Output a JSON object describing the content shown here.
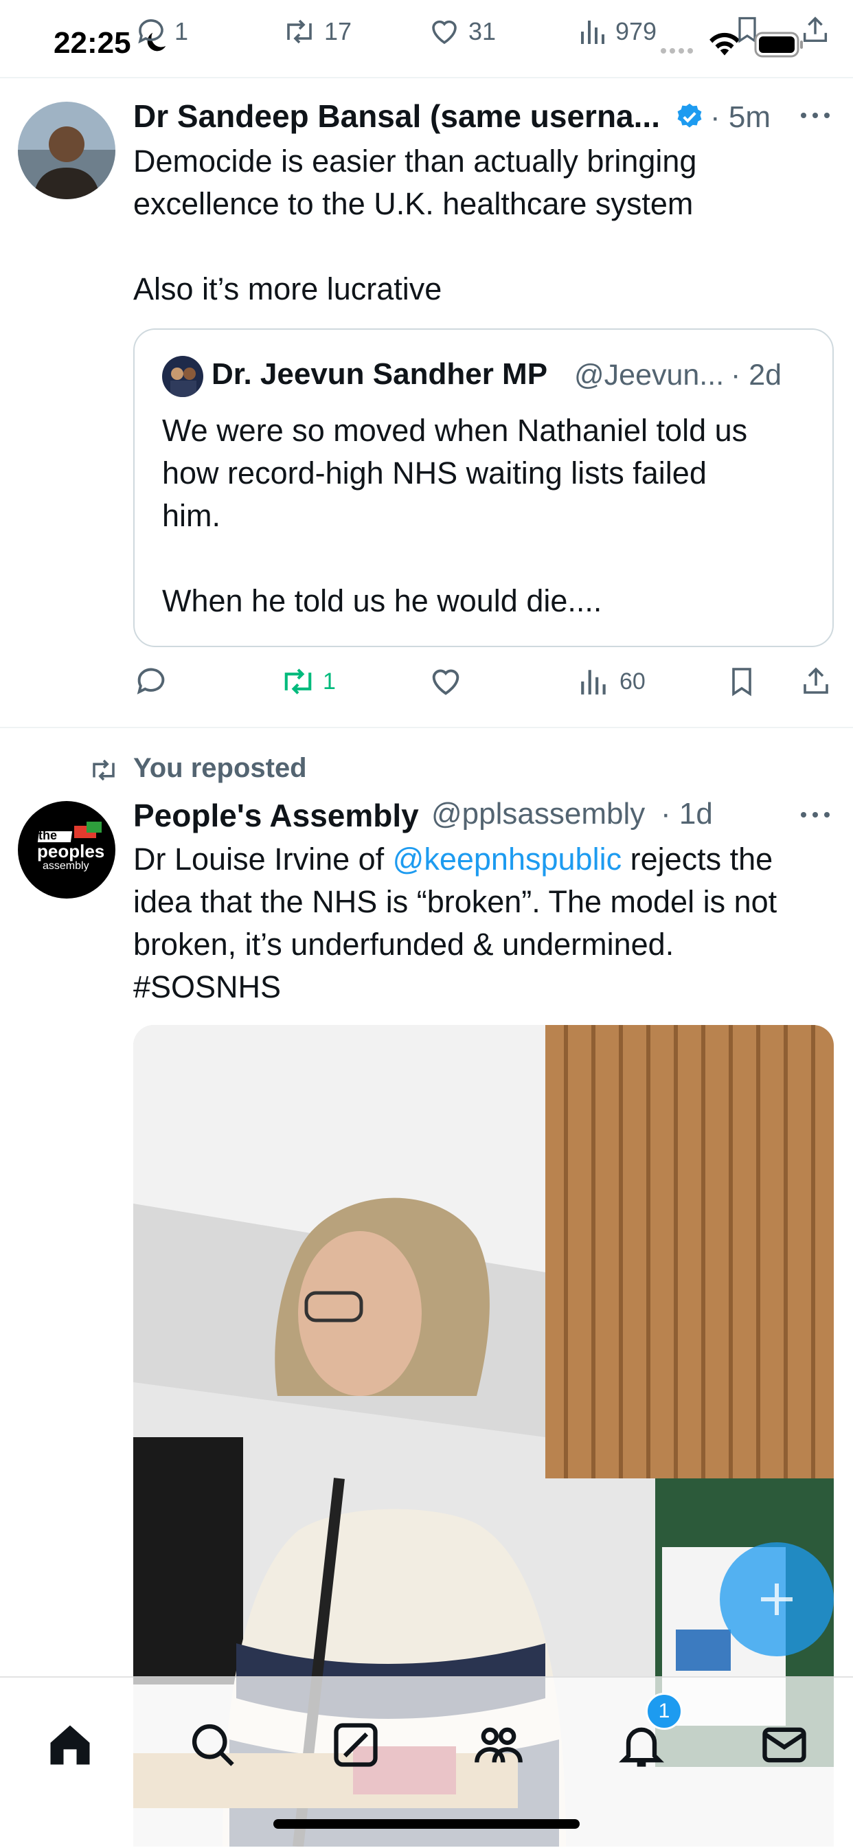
{
  "status_bar": {
    "time": "22:25"
  },
  "prev_tweet_actions": {
    "replies": "1",
    "reposts": "17",
    "likes": "31",
    "views": "979"
  },
  "tweet1": {
    "author_name": "Dr Sandeep Bansal (same userna...",
    "time": "· 5m",
    "text_line1": "Democide is easier than actually bringing",
    "text_line2": "excellence to the U.K. healthcare system",
    "text_line3": "Also it’s more lucrative",
    "quote": {
      "author_name": "Dr. Jeevun Sandher MP",
      "handle": "@Jeevun...",
      "time": "· 2d",
      "line1": "We were so moved when Nathaniel told us",
      "line2": "how record-high NHS waiting lists failed",
      "line3": "him.",
      "line4": "When he told us he would die...."
    },
    "actions": {
      "reposts": "1",
      "views": "60"
    }
  },
  "tweet2": {
    "repost_label": "You reposted",
    "author_name": "People's Assembly",
    "handle": "@pplsassembly",
    "time": "· 1d",
    "avatar_text_1": "the",
    "avatar_text_2": "peoples",
    "avatar_text_3": "assembly",
    "text_pre": "Dr Louise Irvine of ",
    "mention": "@keepnhspublic",
    "text_post": " rejects the",
    "line2": "idea that the NHS is “broken”. The model is not",
    "line3": "broken, it’s underfunded & undermined.",
    "hashtag": "#SOSNHS"
  },
  "bottom_nav": {
    "notifications_badge": "1"
  },
  "colors": {
    "accent": "#1d9bf0",
    "repost_green": "#00ba7c",
    "muted": "#536471"
  }
}
